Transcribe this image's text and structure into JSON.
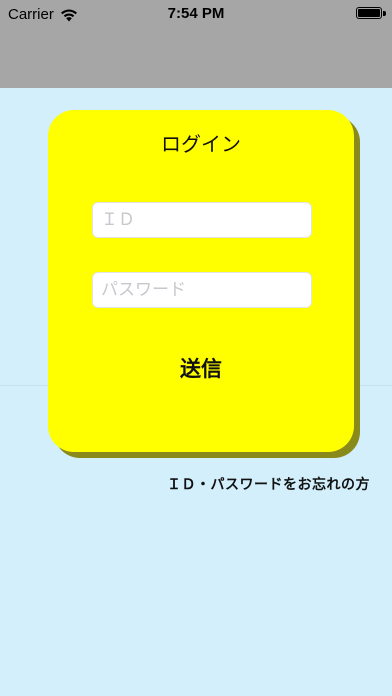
{
  "status_bar": {
    "carrier": "Carrier",
    "time": "7:54 PM",
    "icons": [
      "wifi-icon",
      "battery-icon"
    ]
  },
  "login_card": {
    "title": "ログイン",
    "id_placeholder": "ＩＤ",
    "password_placeholder": "パスワード",
    "submit_label": "送信"
  },
  "forgot_link": "ＩＤ・パスワードをお忘れの方",
  "colors": {
    "background": "#d2effb",
    "nav_bar": "#a6a6a6",
    "card": "#ffff00",
    "card_shadow": "#8a8a1a"
  }
}
